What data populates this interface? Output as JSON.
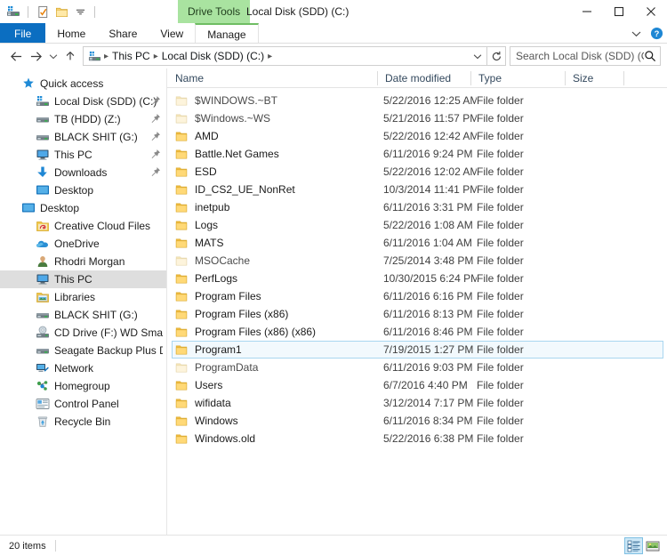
{
  "window": {
    "title": "Local Disk (SDD) (C:)",
    "contextual_tab_label": "Drive Tools",
    "contextual_tab_color": "#a9e3a0",
    "accent_color": "#0b6ec1",
    "minimize_label": "Minimize",
    "maximize_label": "Maximize",
    "close_label": "Close"
  },
  "quick_access_toolbar": {
    "items": [
      {
        "icon": "drive-icon",
        "label": "Customize Quick Access Toolbar"
      },
      {
        "icon": "properties-icon",
        "label": "Properties"
      },
      {
        "icon": "new-folder-icon",
        "label": "New folder"
      },
      {
        "icon": "chevron-down-icon",
        "label": "Customize Quick Access Toolbar"
      }
    ]
  },
  "ribbon": {
    "tabs": [
      {
        "label": "File",
        "active": true,
        "style": "file"
      },
      {
        "label": "Home",
        "active": false,
        "style": "normal"
      },
      {
        "label": "Share",
        "active": false,
        "style": "normal"
      },
      {
        "label": "View",
        "active": false,
        "style": "normal"
      },
      {
        "label": "Manage",
        "active": false,
        "style": "contextual"
      }
    ],
    "expand_label": "Expand the Ribbon",
    "help_label": "Help"
  },
  "address_bar": {
    "back_label": "Back",
    "forward_label": "Forward",
    "recent_label": "Recent locations",
    "up_label": "Up to This PC",
    "breadcrumbs": [
      "This PC",
      "Local Disk (SDD) (C:)"
    ],
    "refresh_label": "Refresh",
    "dropdown_label": "Previous Locations"
  },
  "search": {
    "placeholder": "Search Local Disk (SDD) (C:)",
    "value": ""
  },
  "sidebar": {
    "items": [
      {
        "label": "Quick access",
        "icon": "star-icon",
        "indent": 0,
        "pinned": false,
        "selected": false
      },
      {
        "label": "Local Disk (SDD) (C:)",
        "icon": "drive-icon",
        "indent": 1,
        "pinned": true,
        "selected": false
      },
      {
        "label": "TB (HDD) (Z:)",
        "icon": "hdd-icon",
        "indent": 1,
        "pinned": true,
        "selected": false
      },
      {
        "label": "BLACK SHIT (G:)",
        "icon": "hdd-icon",
        "indent": 1,
        "pinned": true,
        "selected": false
      },
      {
        "label": "This PC",
        "icon": "monitor-icon",
        "indent": 1,
        "pinned": true,
        "selected": false
      },
      {
        "label": "Downloads",
        "icon": "download-icon",
        "indent": 1,
        "pinned": true,
        "selected": false
      },
      {
        "label": "Desktop",
        "icon": "desktop-icon",
        "indent": 1,
        "pinned": false,
        "selected": false
      },
      {
        "label": "Desktop",
        "icon": "desktop-icon",
        "indent": 0,
        "pinned": false,
        "selected": false
      },
      {
        "label": "Creative Cloud Files",
        "icon": "creative-cloud-icon",
        "indent": 1,
        "pinned": false,
        "selected": false
      },
      {
        "label": "OneDrive",
        "icon": "onedrive-icon",
        "indent": 1,
        "pinned": false,
        "selected": false
      },
      {
        "label": "Rhodri Morgan",
        "icon": "user-icon",
        "indent": 1,
        "pinned": false,
        "selected": false
      },
      {
        "label": "This PC",
        "icon": "monitor-icon",
        "indent": 1,
        "pinned": false,
        "selected": true
      },
      {
        "label": "Libraries",
        "icon": "libraries-icon",
        "indent": 1,
        "pinned": false,
        "selected": false
      },
      {
        "label": "BLACK SHIT (G:)",
        "icon": "hdd-icon",
        "indent": 1,
        "pinned": false,
        "selected": false
      },
      {
        "label": "CD Drive (F:) WD SmartWare",
        "icon": "cd-drive-icon",
        "indent": 1,
        "pinned": false,
        "selected": false
      },
      {
        "label": "Seagate Backup Plus Drive (H",
        "icon": "hdd-icon",
        "indent": 1,
        "pinned": false,
        "selected": false
      },
      {
        "label": "Network",
        "icon": "network-icon",
        "indent": 1,
        "pinned": false,
        "selected": false
      },
      {
        "label": "Homegroup",
        "icon": "homegroup-icon",
        "indent": 1,
        "pinned": false,
        "selected": false
      },
      {
        "label": "Control Panel",
        "icon": "control-panel-icon",
        "indent": 1,
        "pinned": false,
        "selected": false
      },
      {
        "label": "Recycle Bin",
        "icon": "recycle-bin-icon",
        "indent": 1,
        "pinned": false,
        "selected": false
      }
    ]
  },
  "file_list": {
    "columns": [
      {
        "label": "Name",
        "key": "name"
      },
      {
        "label": "Date modified",
        "key": "date"
      },
      {
        "label": "Type",
        "key": "type"
      },
      {
        "label": "Size",
        "key": "size"
      }
    ],
    "rows": [
      {
        "name": "$WINDOWS.~BT",
        "date": "5/22/2016 12:25 AM",
        "type": "File folder",
        "size": "",
        "ghosted": true,
        "selected": false
      },
      {
        "name": "$Windows.~WS",
        "date": "5/21/2016 11:57 PM",
        "type": "File folder",
        "size": "",
        "ghosted": true,
        "selected": false
      },
      {
        "name": "AMD",
        "date": "5/22/2016 12:42 AM",
        "type": "File folder",
        "size": "",
        "ghosted": false,
        "selected": false
      },
      {
        "name": "Battle.Net Games",
        "date": "6/11/2016 9:24 PM",
        "type": "File folder",
        "size": "",
        "ghosted": false,
        "selected": false
      },
      {
        "name": "ESD",
        "date": "5/22/2016 12:02 AM",
        "type": "File folder",
        "size": "",
        "ghosted": false,
        "selected": false
      },
      {
        "name": "ID_CS2_UE_NonRet",
        "date": "10/3/2014 11:41 PM",
        "type": "File folder",
        "size": "",
        "ghosted": false,
        "selected": false
      },
      {
        "name": "inetpub",
        "date": "6/11/2016 3:31 PM",
        "type": "File folder",
        "size": "",
        "ghosted": false,
        "selected": false
      },
      {
        "name": "Logs",
        "date": "5/22/2016 1:08 AM",
        "type": "File folder",
        "size": "",
        "ghosted": false,
        "selected": false
      },
      {
        "name": "MATS",
        "date": "6/11/2016 1:04 AM",
        "type": "File folder",
        "size": "",
        "ghosted": false,
        "selected": false
      },
      {
        "name": "MSOCache",
        "date": "7/25/2014 3:48 PM",
        "type": "File folder",
        "size": "",
        "ghosted": true,
        "selected": false
      },
      {
        "name": "PerfLogs",
        "date": "10/30/2015 6:24 PM",
        "type": "File folder",
        "size": "",
        "ghosted": false,
        "selected": false
      },
      {
        "name": "Program Files",
        "date": "6/11/2016 6:16 PM",
        "type": "File folder",
        "size": "",
        "ghosted": false,
        "selected": false
      },
      {
        "name": "Program Files (x86)",
        "date": "6/11/2016 8:13 PM",
        "type": "File folder",
        "size": "",
        "ghosted": false,
        "selected": false
      },
      {
        "name": "Program Files (x86) (x86)",
        "date": "6/11/2016 8:46 PM",
        "type": "File folder",
        "size": "",
        "ghosted": false,
        "selected": false
      },
      {
        "name": "Program1",
        "date": "7/19/2015 1:27 PM",
        "type": "File folder",
        "size": "",
        "ghosted": false,
        "selected": true
      },
      {
        "name": "ProgramData",
        "date": "6/11/2016 9:03 PM",
        "type": "File folder",
        "size": "",
        "ghosted": true,
        "selected": false
      },
      {
        "name": "Users",
        "date": "6/7/2016 4:40 PM",
        "type": "File folder",
        "size": "",
        "ghosted": false,
        "selected": false
      },
      {
        "name": "wifidata",
        "date": "3/12/2014 7:17 PM",
        "type": "File folder",
        "size": "",
        "ghosted": false,
        "selected": false
      },
      {
        "name": "Windows",
        "date": "6/11/2016 8:34 PM",
        "type": "File folder",
        "size": "",
        "ghosted": false,
        "selected": false
      },
      {
        "name": "Windows.old",
        "date": "5/22/2016 6:38 PM",
        "type": "File folder",
        "size": "",
        "ghosted": false,
        "selected": false
      }
    ]
  },
  "status_bar": {
    "item_count_text": "20 items",
    "details_view_label": "Details view",
    "large_icons_view_label": "Large icons view",
    "active_view": "details"
  }
}
